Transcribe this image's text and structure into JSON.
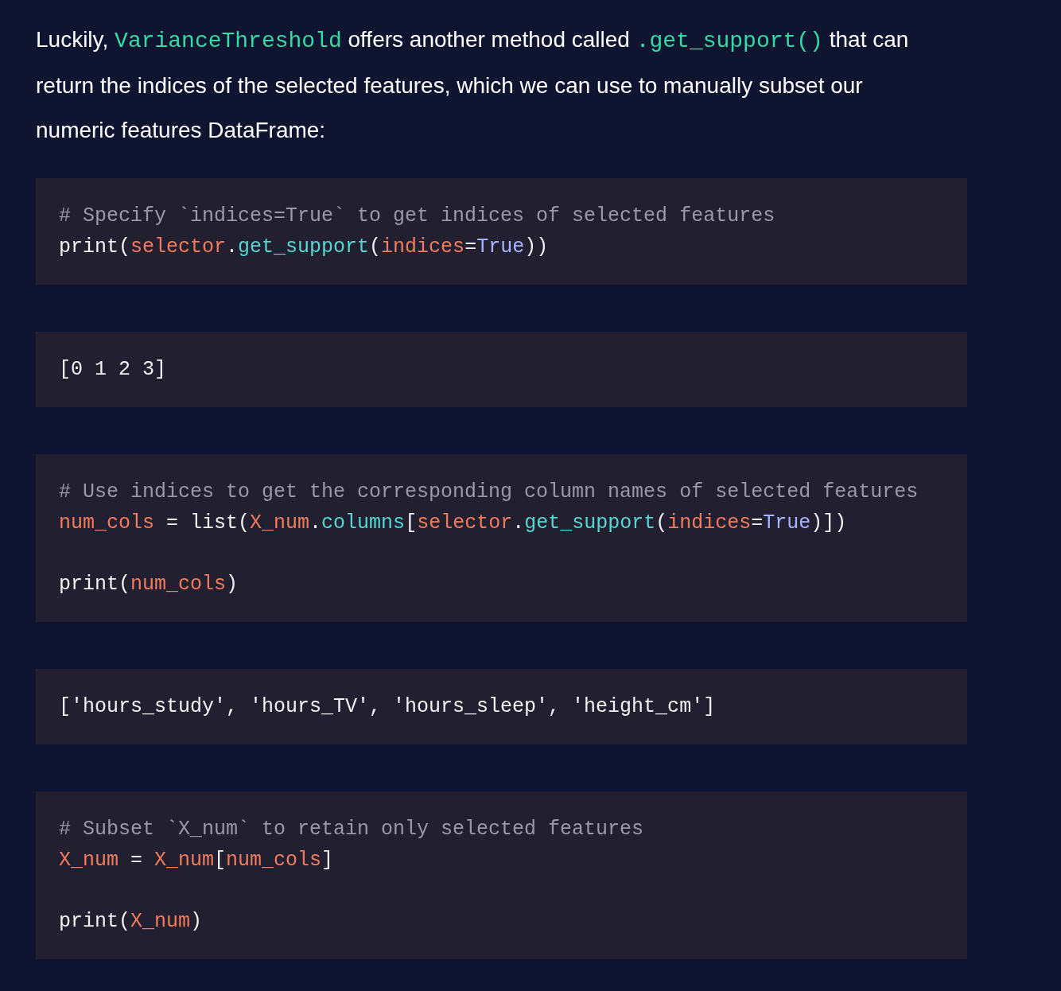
{
  "paragraph": [
    {
      "kind": "text",
      "text": "Luckily, "
    },
    {
      "kind": "code",
      "text": "VarianceThreshold"
    },
    {
      "kind": "text",
      "text": " offers another method called "
    },
    {
      "kind": "code",
      "text": ".get_support()"
    },
    {
      "kind": "text",
      "text": " that can return the indices of the selected features, which we can use to manually subset our numeric features DataFrame:"
    }
  ],
  "blocks": [
    {
      "lines": [
        {
          "kind": "code",
          "tokens": [
            {
              "kind": "comment",
              "text": "# Specify `indices=True` to get indices of selected features"
            }
          ]
        },
        {
          "kind": "code",
          "tokens": [
            {
              "kind": "plain",
              "text": "print("
            },
            {
              "kind": "name",
              "text": "selector"
            },
            {
              "kind": "plain",
              "text": "."
            },
            {
              "kind": "method",
              "text": "get_support"
            },
            {
              "kind": "plain",
              "text": "("
            },
            {
              "kind": "name",
              "text": "indices"
            },
            {
              "kind": "plain",
              "text": "="
            },
            {
              "kind": "literal",
              "text": "True"
            },
            {
              "kind": "plain",
              "text": "))"
            }
          ]
        }
      ]
    },
    {
      "lines": [
        {
          "kind": "code",
          "tokens": [
            {
              "kind": "plain",
              "text": "[0 1 2 3]"
            }
          ]
        }
      ]
    },
    {
      "lines": [
        {
          "kind": "code",
          "tokens": [
            {
              "kind": "comment",
              "text": "# Use indices to get the corresponding column names of selected features"
            }
          ]
        },
        {
          "kind": "code",
          "tokens": [
            {
              "kind": "name",
              "text": "num_cols"
            },
            {
              "kind": "plain",
              "text": " = list("
            },
            {
              "kind": "name",
              "text": "X_num"
            },
            {
              "kind": "plain",
              "text": "."
            },
            {
              "kind": "method",
              "text": "columns"
            },
            {
              "kind": "plain",
              "text": "["
            },
            {
              "kind": "name",
              "text": "selector"
            },
            {
              "kind": "plain",
              "text": "."
            },
            {
              "kind": "method",
              "text": "get_support"
            },
            {
              "kind": "plain",
              "text": "("
            },
            {
              "kind": "name",
              "text": "indices"
            },
            {
              "kind": "plain",
              "text": "="
            },
            {
              "kind": "literal",
              "text": "True"
            },
            {
              "kind": "plain",
              "text": ")])"
            }
          ]
        },
        {
          "kind": "blank"
        },
        {
          "kind": "code",
          "tokens": [
            {
              "kind": "plain",
              "text": "print("
            },
            {
              "kind": "name",
              "text": "num_cols"
            },
            {
              "kind": "plain",
              "text": ")"
            }
          ]
        }
      ]
    },
    {
      "lines": [
        {
          "kind": "code",
          "tokens": [
            {
              "kind": "plain",
              "text": "['hours_study', 'hours_TV', 'hours_sleep', 'height_cm']"
            }
          ]
        }
      ]
    },
    {
      "lines": [
        {
          "kind": "code",
          "tokens": [
            {
              "kind": "comment",
              "text": "# Subset `X_num` to retain only selected features"
            }
          ]
        },
        {
          "kind": "code",
          "tokens": [
            {
              "kind": "name",
              "text": "X_num"
            },
            {
              "kind": "plain",
              "text": " = "
            },
            {
              "kind": "name",
              "text": "X_num"
            },
            {
              "kind": "plain",
              "text": "["
            },
            {
              "kind": "name",
              "text": "num_cols"
            },
            {
              "kind": "plain",
              "text": "]"
            }
          ]
        },
        {
          "kind": "blank"
        },
        {
          "kind": "code",
          "tokens": [
            {
              "kind": "plain",
              "text": "print("
            },
            {
              "kind": "name",
              "text": "X_num"
            },
            {
              "kind": "plain",
              "text": ")"
            }
          ]
        }
      ]
    }
  ]
}
